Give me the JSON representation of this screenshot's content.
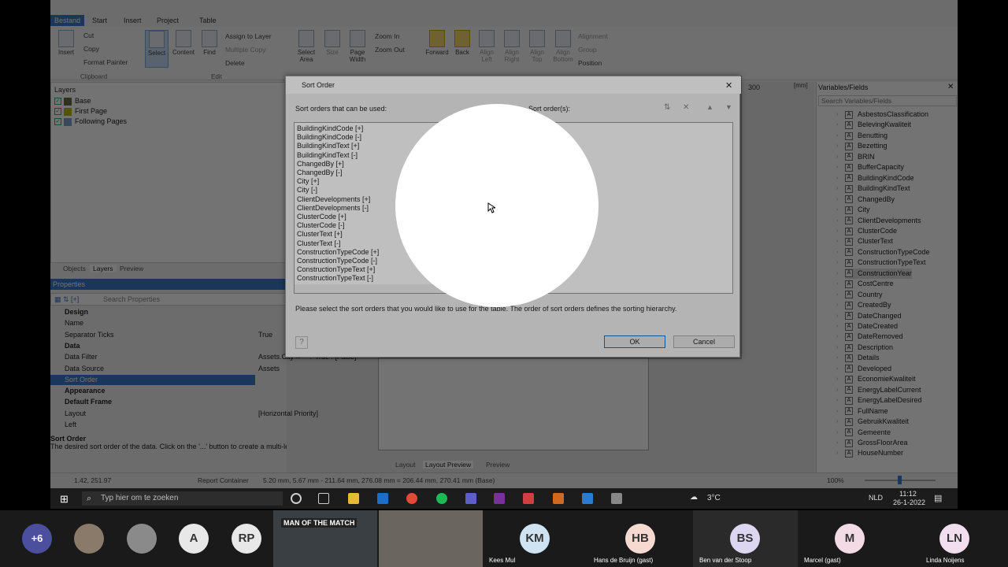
{
  "ribbon": {
    "tabs": [
      "Bestand",
      "Start",
      "Insert",
      "Project",
      "Table"
    ],
    "clipboard": {
      "insert": "Insert",
      "cut": "Cut",
      "copy": "Copy",
      "format_painter": "Format Painter",
      "group": "Clipboard"
    },
    "edit": {
      "select": "Select",
      "content": "Content",
      "find": "Find",
      "assign": "Assign to Layer",
      "multiple": "Multiple Copy",
      "delete": "Delete",
      "group": "Edit"
    },
    "view": {
      "select_area": "Select Area",
      "size": "Size",
      "page_width": "Page Width",
      "zoom_in": "Zoom In",
      "zoom_out": "Zoom Out"
    },
    "arrange": {
      "forward": "Forward",
      "back": "Back",
      "align_left": "Align Left",
      "align_right": "Align Right",
      "align_top": "Align Top",
      "align_bottom": "Align Bottom",
      "alignment": "Alignment",
      "group_btn": "Group",
      "position": "Position"
    }
  },
  "layers": {
    "title": "Layers",
    "items": [
      {
        "label": "Base",
        "color": "#6b6b4a"
      },
      {
        "label": "First Page",
        "color": "#b8b81a"
      },
      {
        "label": "Following Pages",
        "color": "#7aa3cf"
      }
    ]
  },
  "panel_tabs": [
    "Objects",
    "Layers",
    "Preview"
  ],
  "properties": {
    "title": "Properties",
    "search_placeholder": "Search Properties",
    "rows": [
      {
        "key": "Design",
        "value": "",
        "cat": true
      },
      {
        "key": "Name",
        "value": ""
      },
      {
        "key": "Separator Ticks",
        "value": "True"
      },
      {
        "key": "Data",
        "value": "",
        "cat": true
      },
      {
        "key": "Data Filter",
        "value": "Assets.City<>\"\" ? True : [False]"
      },
      {
        "key": "Data Source",
        "value": "Assets"
      },
      {
        "key": "Sort Order",
        "value": ""
      },
      {
        "key": "Appearance",
        "value": "",
        "cat": true
      },
      {
        "key": "Default Frame",
        "value": "",
        "cat": true
      },
      {
        "key": "Layout",
        "value": "[Horizontal Priority]"
      },
      {
        "key": "Left",
        "value": ""
      }
    ],
    "desc_title": "Sort Order",
    "desc_text": "The desired sort order of the data. Click on the '...' button to create a multi-level sort order."
  },
  "ruler": {
    "mark": "300",
    "unit": "[mm]"
  },
  "canvas_tabs": [
    "Layout",
    "Layout Preview",
    "Preview"
  ],
  "variables": {
    "title": "Variables/Fields",
    "search_placeholder": "Search Variables/Fields",
    "items": [
      "AsbestosClassification",
      "BelevingKwaliteit",
      "Benutting",
      "Bezetting",
      "BRIN",
      "BufferCapacity",
      "BuildingKindCode",
      "BuildingKindText",
      "ChangedBy",
      "City",
      "ClientDevelopments",
      "ClusterCode",
      "ClusterText",
      "ConstructionTypeCode",
      "ConstructionTypeText",
      "ConstructionYear",
      "CostCentre",
      "Country",
      "CreatedBy",
      "DateChanged",
      "DateCreated",
      "DateRemoved",
      "Description",
      "Details",
      "Developed",
      "EconomieKwaliteit",
      "EnergyLabelCurrent",
      "EnergyLabelDesired",
      "FullName",
      "GebruikKwaliteit",
      "Gemeente",
      "GrossFloorArea",
      "HouseNumber"
    ]
  },
  "status": {
    "coords": "1.42, 251.97",
    "object": "Report Container",
    "dims": "5.20 mm, 5.67 mm - 211.64 mm, 276.08 mm = 206.44 mm, 270.41 mm (Base)",
    "zoom": "100%"
  },
  "dialog": {
    "title": "Sort Order",
    "available_label": "Sort orders that can be used:",
    "selected_label": "Sort order(s):",
    "available": [
      "BuildingKindCode [+]",
      "BuildingKindCode [-]",
      "BuildingKindText [+]",
      "BuildingKindText [-]",
      "ChangedBy [+]",
      "ChangedBy [-]",
      "City [+]",
      "City [-]",
      "ClientDevelopments [+]",
      "ClientDevelopments [-]",
      "ClusterCode [+]",
      "ClusterCode [-]",
      "ClusterText [+]",
      "ClusterText [-]",
      "ConstructionTypeCode [+]",
      "ConstructionTypeCode [-]",
      "ConstructionTypeText [+]",
      "ConstructionTypeText [-]"
    ],
    "hint": "Please select the sort orders that you would like to use for the table. The order of sort orders defines the sorting hierarchy.",
    "ok": "OK",
    "cancel": "Cancel"
  },
  "taskbar": {
    "search": "Typ hier om te zoeken",
    "weather": "3°C",
    "lang": "NLD",
    "time": "11:12",
    "date": "26-1-2022"
  },
  "meeting": {
    "more": "+6",
    "tiles": [
      {
        "initials": "A",
        "name": "",
        "bg": "#e8e8e8",
        "fg": "#333"
      },
      {
        "initials": "RP",
        "name": "",
        "bg": "#e8e8e8",
        "fg": "#333"
      },
      {
        "initials": "KM",
        "name": "Kees Mul",
        "bg": "#cfe3f3",
        "fg": "#333"
      },
      {
        "initials": "HB",
        "name": "Hans de Bruijn (gast)",
        "bg": "#f6d9d0",
        "fg": "#333"
      },
      {
        "initials": "BS",
        "name": "Ben van der Stoop",
        "bg": "#ddd6f0",
        "fg": "#333"
      },
      {
        "initials": "M",
        "name": "Marcel (gast)",
        "bg": "#f3dbe6",
        "fg": "#333"
      },
      {
        "initials": "LN",
        "name": "Linda Noijens",
        "bg": "#f1dfef",
        "fg": "#333"
      }
    ],
    "banner": "MAN OF THE MATCH"
  }
}
